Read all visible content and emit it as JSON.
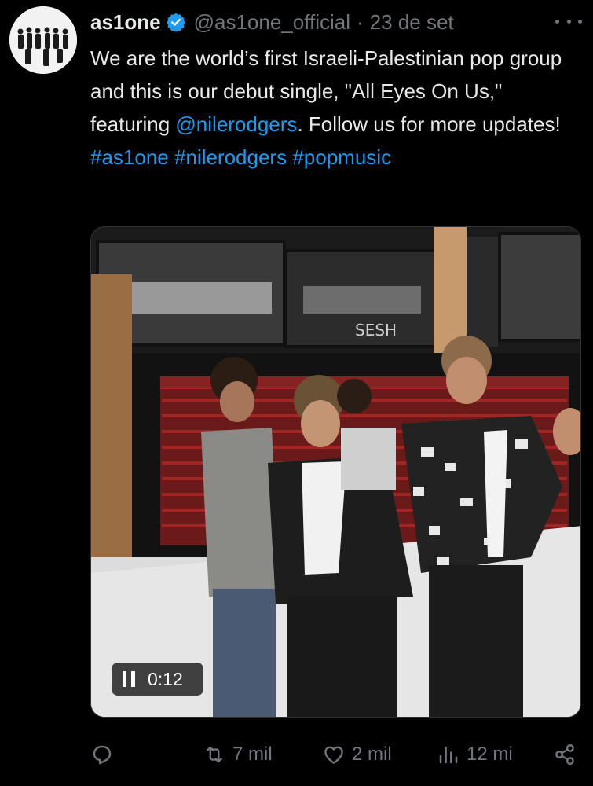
{
  "tweet": {
    "author_name": "as1one",
    "handle": "@as1one_official",
    "separator": "·",
    "date": "23 de set",
    "text_parts": {
      "p1": "We are the world’s first Israeli-Palestinian pop group and this is our debut single, \"All Eyes On Us,\" featuring ",
      "mention": "@nilerodgers",
      "p2": ". Follow us for more updates!  ",
      "hashtag1": "#as1one",
      "hashtag2": "#nilerodgers",
      "hashtag3": "#popmusic"
    }
  },
  "media": {
    "type": "video",
    "elapsed_time": "0:12",
    "sign_text": "SESH"
  },
  "actions": {
    "reply_icon": "reply-icon",
    "retweet_count": "7 mil",
    "like_count": "2 mil",
    "views_count": "12 mi",
    "share_icon": "share-icon"
  },
  "colors": {
    "background": "#000000",
    "text": "#e7e9ea",
    "secondary": "#71767b",
    "link": "#1d9bf0",
    "verified": "#1d9bf0"
  }
}
